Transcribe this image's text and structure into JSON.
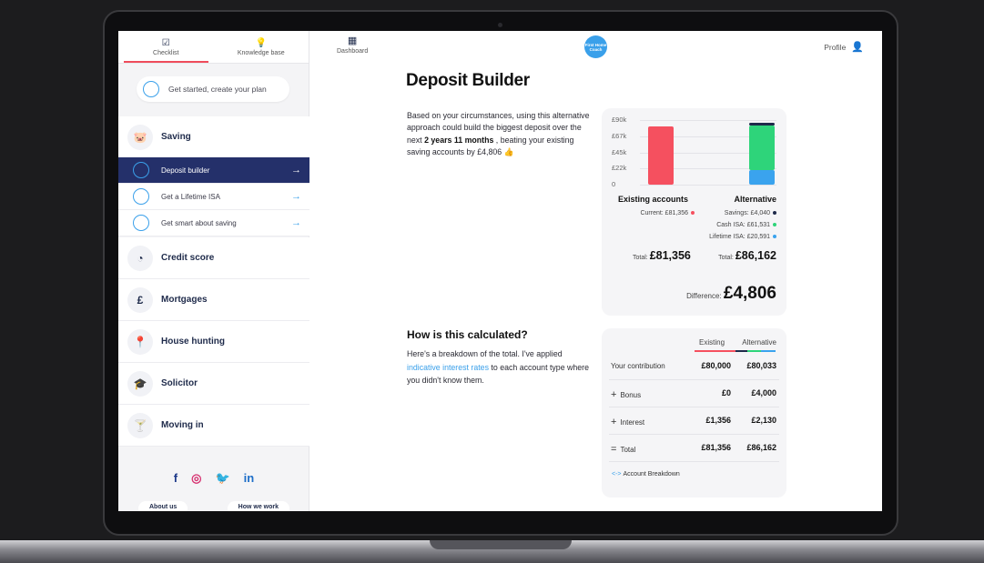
{
  "sidebar": {
    "tabs": [
      {
        "label": "Checklist",
        "icon": "checklist-icon",
        "active": true
      },
      {
        "label": "Knowledge base",
        "icon": "lightbulb-icon",
        "active": false
      }
    ],
    "get_started": "Get started, create your plan",
    "saving": {
      "label": "Saving",
      "icon": "piggy-bank-icon",
      "items": [
        {
          "label": "Deposit builder",
          "active": true
        },
        {
          "label": "Get a Lifetime ISA",
          "active": false
        },
        {
          "label": "Get smart about saving",
          "active": false
        }
      ]
    },
    "sections": [
      {
        "label": "Credit score",
        "icon": "gauge-icon"
      },
      {
        "label": "Mortgages",
        "icon": "pound-card-icon"
      },
      {
        "label": "House hunting",
        "icon": "location-pin-icon"
      },
      {
        "label": "Solicitor",
        "icon": "graduation-cap-icon"
      },
      {
        "label": "Moving in",
        "icon": "cocktail-glass-icon"
      }
    ],
    "social": [
      "facebook-icon",
      "instagram-icon",
      "twitter-icon",
      "linkedin-icon"
    ],
    "footer": {
      "about": "About us",
      "how": "How we work"
    }
  },
  "header": {
    "dashboard": "Dashboard",
    "logo_text": "First Home Coach",
    "profile": "Profile"
  },
  "page": {
    "title": "Deposit Builder",
    "intro_1": "Based on your circumstances, using this alternative approach could build the biggest deposit over the next ",
    "intro_bold": "2 years 11 months",
    "intro_2": " , beating your existing saving accounts by £4,806 👍",
    "how_title": "How is this calculated?",
    "how_1": "Here's a breakdown of the total. I've applied ",
    "how_link": "indicative interest rates",
    "how_2": " to each account type where you didn't know them."
  },
  "chart_data": {
    "type": "bar",
    "categories": [
      "Existing accounts",
      "Alternative"
    ],
    "yticks": [
      "£90k",
      "£67k",
      "£45k",
      "£22k",
      "0"
    ],
    "ylim": [
      0,
      90000
    ],
    "series": [
      {
        "name": "Current",
        "color": "#f5505f",
        "values": [
          81356,
          0
        ]
      },
      {
        "name": "Lifetime ISA",
        "color": "#3aa3ee",
        "values": [
          0,
          20591
        ]
      },
      {
        "name": "Cash ISA",
        "color": "#2ed47a",
        "values": [
          0,
          61531
        ]
      },
      {
        "name": "Savings",
        "color": "#1e2a4a",
        "values": [
          0,
          4040
        ]
      }
    ],
    "existing_legend": [
      {
        "text": "Current: £81,356",
        "color": "#f5505f"
      }
    ],
    "alternative_legend": [
      {
        "text": "Savings: £4,040",
        "color": "#1e2a4a"
      },
      {
        "text": "Cash ISA: £61,531",
        "color": "#2ed47a"
      },
      {
        "text": "Lifetime ISA: £20,591",
        "color": "#3aa3ee"
      }
    ],
    "total_label": "Total:",
    "existing_total": "£81,356",
    "alternative_total": "£86,162",
    "difference_label": "Difference:",
    "difference": "£4,806"
  },
  "breakdown_table": {
    "headers": [
      "Existing",
      "Alternative"
    ],
    "rows": [
      {
        "label": "Your contribution",
        "prefix": "",
        "existing": "£80,000",
        "alternative": "£80,033"
      },
      {
        "label": "Bonus",
        "prefix": "+",
        "existing": "£0",
        "alternative": "£4,000"
      },
      {
        "label": "Interest",
        "prefix": "+",
        "existing": "£1,356",
        "alternative": "£2,130"
      },
      {
        "label": "Total",
        "prefix": "=",
        "existing": "£81,356",
        "alternative": "£86,162"
      }
    ],
    "footer_link": "Account Breakdown"
  }
}
